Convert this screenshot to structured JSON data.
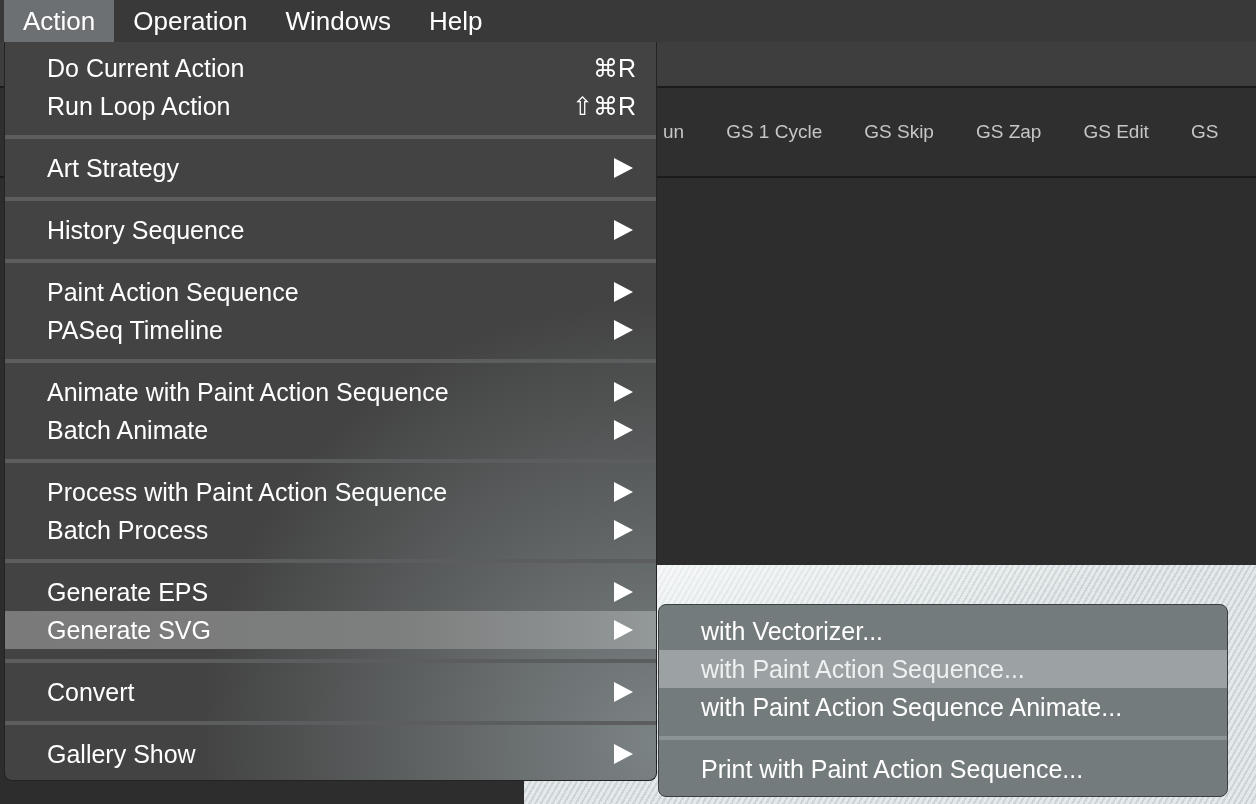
{
  "menu_bar": [
    {
      "label": "Action",
      "selected": true
    },
    {
      "label": "Operation",
      "selected": false
    },
    {
      "label": "Windows",
      "selected": false
    },
    {
      "label": "Help",
      "selected": false
    }
  ],
  "toolbar": {
    "buttons": [
      "un",
      "GS 1 Cycle",
      "GS Skip",
      "GS Zap",
      "GS Edit",
      "GS"
    ]
  },
  "action_menu": {
    "groups": [
      {
        "items": [
          {
            "label": "Do Current Action",
            "kind": "command",
            "shortcut": "⌘R",
            "selected": false
          },
          {
            "label": "Run Loop Action",
            "kind": "command",
            "shortcut": "⇧⌘R",
            "selected": false
          }
        ]
      },
      {
        "items": [
          {
            "label": "Art Strategy",
            "kind": "submenu",
            "selected": false
          }
        ]
      },
      {
        "items": [
          {
            "label": "History Sequence",
            "kind": "submenu",
            "selected": false
          }
        ]
      },
      {
        "items": [
          {
            "label": "Paint Action Sequence",
            "kind": "submenu",
            "selected": false
          },
          {
            "label": "PASeq Timeline",
            "kind": "submenu",
            "selected": false
          }
        ]
      },
      {
        "items": [
          {
            "label": "Animate with Paint Action Sequence",
            "kind": "submenu",
            "selected": false
          },
          {
            "label": "Batch Animate",
            "kind": "submenu",
            "selected": false
          }
        ]
      },
      {
        "items": [
          {
            "label": "Process with Paint Action Sequence",
            "kind": "submenu",
            "selected": false
          },
          {
            "label": "Batch Process",
            "kind": "submenu",
            "selected": false
          }
        ]
      },
      {
        "items": [
          {
            "label": "Generate EPS",
            "kind": "submenu",
            "selected": false
          },
          {
            "label": "Generate SVG",
            "kind": "submenu",
            "selected": true
          }
        ]
      },
      {
        "items": [
          {
            "label": "Convert",
            "kind": "submenu",
            "selected": false
          }
        ]
      },
      {
        "items": [
          {
            "label": "Gallery Show",
            "kind": "submenu",
            "selected": false
          }
        ]
      }
    ]
  },
  "generate_svg_submenu": {
    "groups": [
      {
        "items": [
          {
            "label": "with Vectorizer...",
            "selected": false
          },
          {
            "label": "with Paint Action Sequence...",
            "selected": true
          },
          {
            "label": "with Paint Action Sequence Animate...",
            "selected": false
          }
        ]
      },
      {
        "items": [
          {
            "label": "Print with Paint Action Sequence...",
            "selected": false
          }
        ]
      }
    ]
  }
}
